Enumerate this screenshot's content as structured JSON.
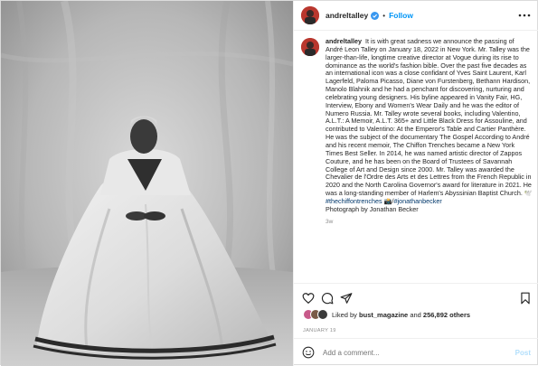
{
  "post": {
    "username": "andreltalley",
    "follow_label": "Follow",
    "dot": "•",
    "caption": {
      "username": "andreltalley",
      "text": "It is with great sadness we announce the passing of André Leon Talley on January 18, 2022 in New York. Mr. Talley was the larger-than-life, longtime creative director at Vogue during its rise to dominance as the world's fashion bible. Over the past five decades as an international icon was a close confidant of Yves Saint Laurent, Karl Lagerfeld, Paloma Picasso, Diane von Furstenberg, Bethann Hardison, Manolo Blahnik and he had a penchant for discovering, nurturing and celebrating young designers. His byline appeared in Vanity Fair, HG, Interview, Ebony and Women's Wear Daily and he was the editor of Numero Russia. Mr. Talley wrote several books, including Valentino, A.L.T.: A Memoir, A.L.T. 365+ and Little Black Dress for Assouline, and contributed to Valentino: At the Emperor's Table and Cartier Panthère. He was the subject of the documentary The Gospel According to André and his recent memoir, The Chiffon Trenches became a New York Times Best Seller. In 2014, he was named artistic director of Zappos Couture, and he has been on the Board of Trustees of Savannah College of Art and Design since 2000. Mr. Talley was awarded the Chevalier de l'Ordre des Arts et des Lettres from the French Republic in 2020 and the North Carolina Governor's award for literature in 2021. He was a long-standing member of Harlem's Abyssinian Baptist Church. 🕊️",
      "hashtag1": "#thechiffontrenches",
      "emoji": "📸/",
      "hashtag2": "#jonathanbecker",
      "credit": "Photograph by Jonathan Becker",
      "age": "3w"
    },
    "likes": {
      "prefix": "Liked by",
      "user": "bust_magazine",
      "and": "and",
      "count": "256,892 others"
    },
    "date": "JANUARY 19",
    "comment": {
      "placeholder": "Add a comment...",
      "post_label": "Post"
    },
    "colors": {
      "link": "#00376b",
      "follow": "#0095f6",
      "post_disabled": "#b2dffc",
      "muted": "#8e8e8e"
    },
    "icons": [
      "verified-badge-icon",
      "more-options-icon",
      "heart-icon",
      "comment-icon",
      "share-icon",
      "bookmark-icon",
      "emoji-icon"
    ]
  }
}
